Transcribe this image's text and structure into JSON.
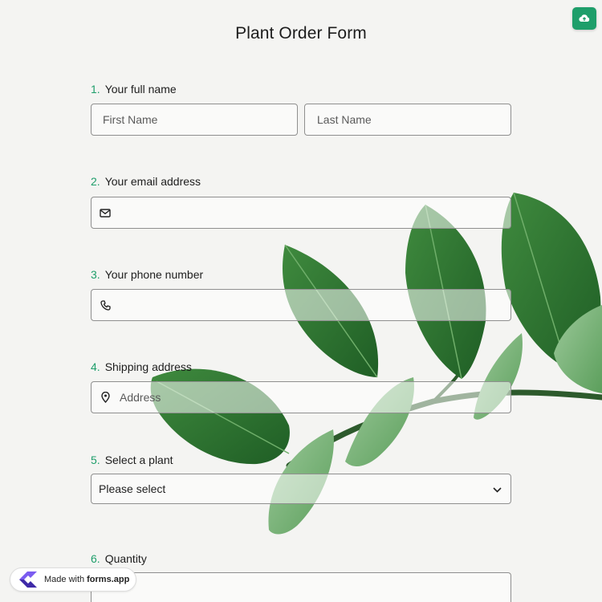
{
  "form": {
    "title": "Plant Order Form",
    "accent_color": "#1e9e6a",
    "upload_icon": "cloud-upload-icon"
  },
  "questions": [
    {
      "number": "1.",
      "label": "Your full name",
      "first_placeholder": "First Name",
      "last_placeholder": "Last Name"
    },
    {
      "number": "2.",
      "label": "Your email address",
      "icon": "envelope-icon",
      "value": ""
    },
    {
      "number": "3.",
      "label": "Your phone number",
      "icon": "phone-icon",
      "value": ""
    },
    {
      "number": "4.",
      "label": "Shipping address",
      "icon": "map-pin-icon",
      "placeholder": "Address"
    },
    {
      "number": "5.",
      "label": "Select a plant",
      "selected": "Please select",
      "icon": "chevron-down-icon"
    },
    {
      "number": "6.",
      "label": "Quantity"
    }
  ],
  "badge": {
    "prefix": "Made with",
    "brand": "forms.app",
    "icon": "forms-app-logo-icon"
  }
}
